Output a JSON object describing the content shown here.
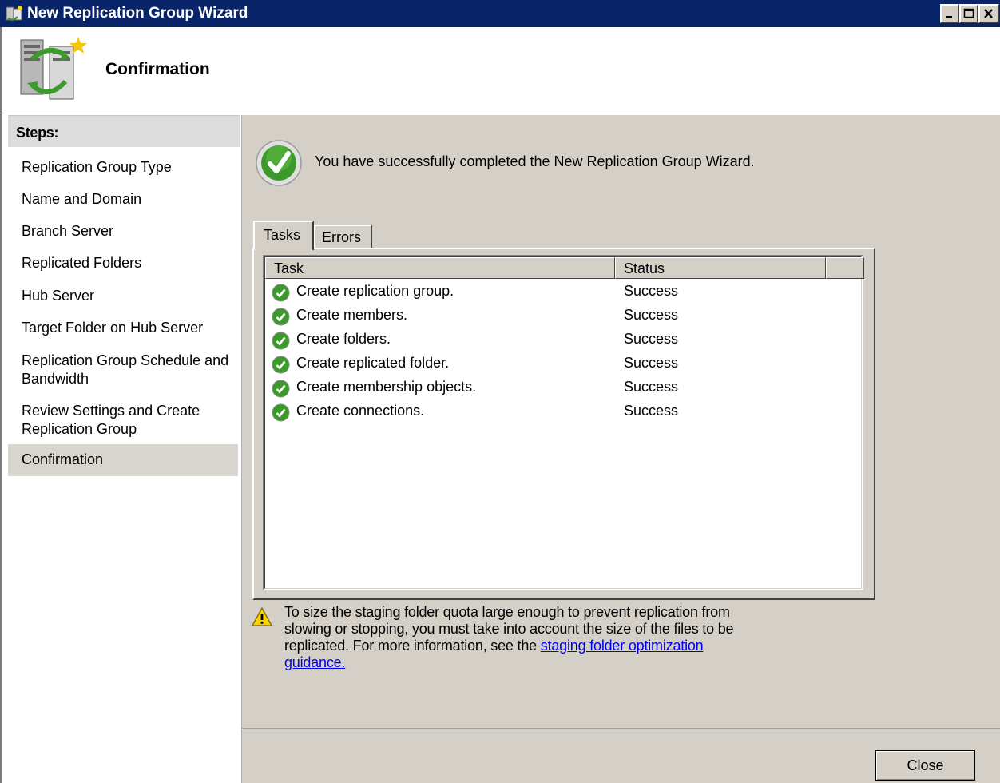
{
  "window": {
    "title": "New Replication Group Wizard"
  },
  "header": {
    "title": "Confirmation"
  },
  "steps": {
    "heading": "Steps:",
    "items": [
      {
        "label": "Replication Group Type"
      },
      {
        "label": "Name and Domain"
      },
      {
        "label": "Branch Server"
      },
      {
        "label": "Replicated Folders"
      },
      {
        "label": "Hub Server"
      },
      {
        "label": "Target Folder on Hub Server"
      },
      {
        "label": "Replication Group Schedule and Bandwidth"
      },
      {
        "label": "Review Settings and Create Replication Group"
      },
      {
        "label": "Confirmation"
      }
    ],
    "current": "Confirmation"
  },
  "main": {
    "success_message": "You have successfully completed the New Replication Group Wizard.",
    "tabs": [
      {
        "label": "Tasks",
        "selected": true
      },
      {
        "label": "Errors",
        "selected": false
      }
    ],
    "columns": {
      "task": "Task",
      "status": "Status"
    },
    "rows": [
      {
        "task": "Create replication group.",
        "status": "Success"
      },
      {
        "task": "Create members.",
        "status": "Success"
      },
      {
        "task": "Create folders.",
        "status": "Success"
      },
      {
        "task": "Create replicated folder.",
        "status": "Success"
      },
      {
        "task": "Create membership objects.",
        "status": "Success"
      },
      {
        "task": "Create connections.",
        "status": "Success"
      }
    ],
    "warning_text": "To size the staging folder quota large enough to prevent replication from slowing or stopping, you must take into account the size of the files to be replicated. For more information, see the",
    "warning_link": "staging folder optimization guidance."
  },
  "footer": {
    "close_label": "Close"
  },
  "icons": {
    "title": "wizard-app-icon",
    "header": "replication-servers-icon",
    "success": "check-circle-icon",
    "warning": "warning-icon"
  },
  "colors": {
    "titlebar": "#0a246a",
    "success_green": "#3c9a2c",
    "link": "#0000ee",
    "selected_step": "#d8d5ce"
  }
}
